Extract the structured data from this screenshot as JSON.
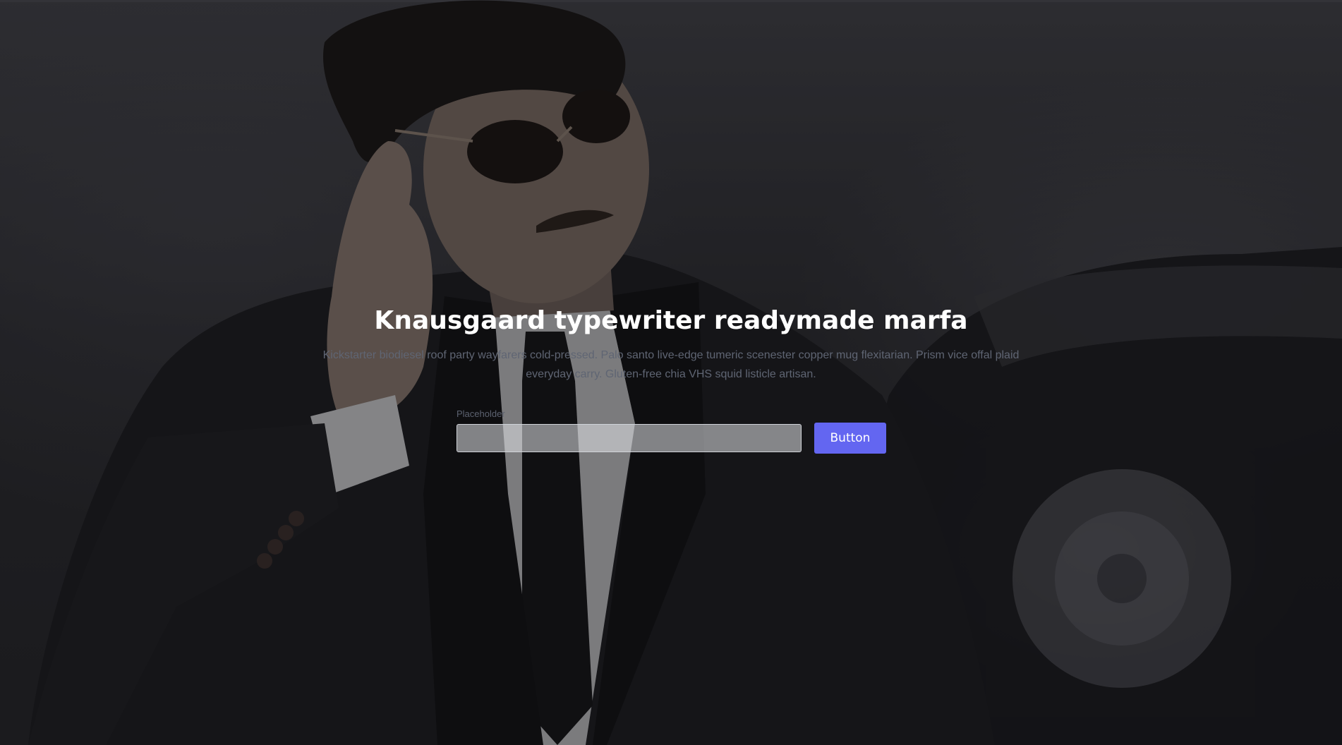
{
  "hero": {
    "title": "Knausgaard typewriter readymade marfa",
    "description": "Kickstarter biodiesel roof party wayfarers cold-pressed. Palo santo live-edge tumeric scenester copper mug flexitarian. Prism vice offal plaid everyday carry. Gluten-free chia VHS squid listicle artisan.",
    "background_image": "man-in-suit-sunglasses-earpiece-photo"
  },
  "form": {
    "field_label": "Placeholder",
    "field_value": "",
    "button_label": "Button"
  },
  "colors": {
    "accent": "#6366f1",
    "title": "#ffffff",
    "description": "#5f6573"
  }
}
